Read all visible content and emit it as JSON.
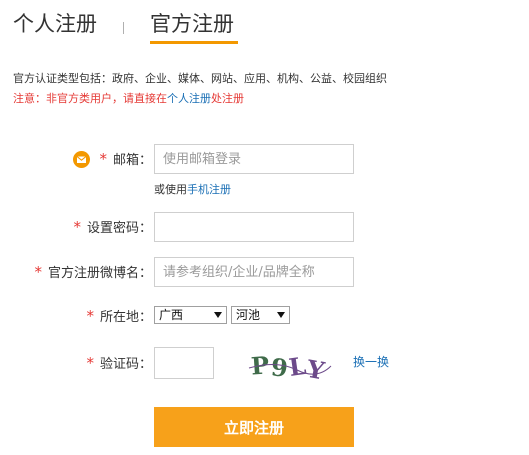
{
  "tabs": {
    "personal": "个人注册",
    "official": "官方注册"
  },
  "info": {
    "types": "官方认证类型包括：政府、企业、媒体、网站、应用、机构、公益、校园组织",
    "note_prefix": "注意：非官方类用户，请直接在",
    "note_link": "个人注册",
    "note_suffix": "处注册"
  },
  "form": {
    "required_mark": "*",
    "email": {
      "label": "邮箱：",
      "placeholder": "使用邮箱登录",
      "icon": "email-icon"
    },
    "alt_register": {
      "prefix": "或使用",
      "link": "手机注册"
    },
    "password": {
      "label": "设置密码：",
      "value": ""
    },
    "weibo_name": {
      "label": "官方注册微博名：",
      "placeholder": "请参考组织/企业/品牌全称"
    },
    "location": {
      "label": "所在地：",
      "province": "广西",
      "city": "河池"
    },
    "captcha": {
      "label": "验证码：",
      "value": "",
      "image_text": "P9LY",
      "refresh": "换一换"
    },
    "submit": "立即注册"
  },
  "colors": {
    "accent": "#f39800",
    "button": "#f7a11a",
    "link": "#1a6fb5",
    "required": "#e53935"
  }
}
